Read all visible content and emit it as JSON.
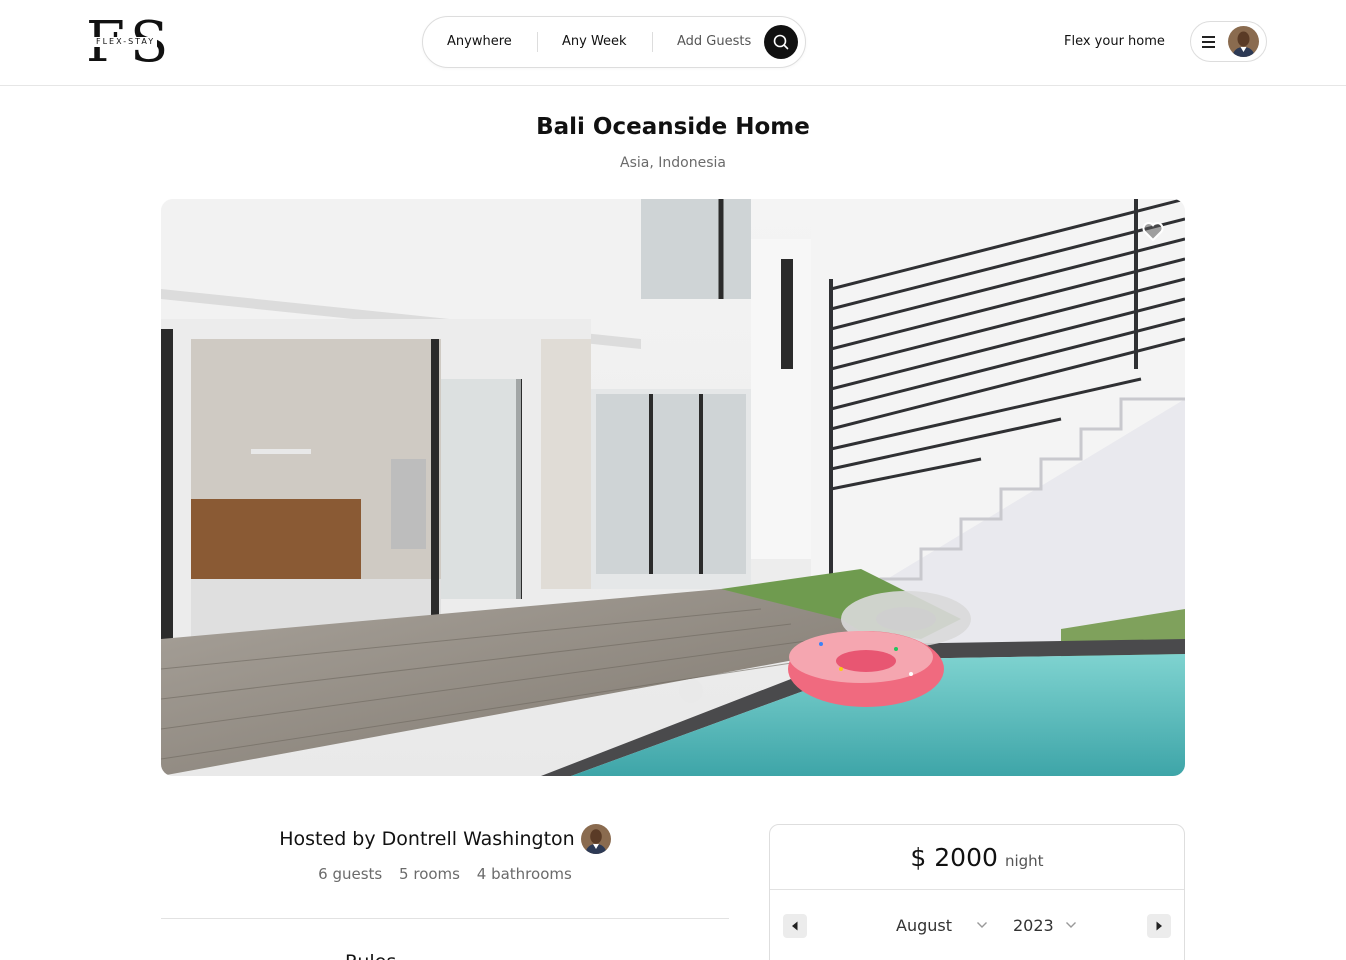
{
  "brand": {
    "monogram_left": "F",
    "monogram_right": "S",
    "wordmark": "FLEX-STAY"
  },
  "search": {
    "anywhere": "Anywhere",
    "any_week": "Any Week",
    "add_guests": "Add Guests",
    "button_icon": "search-icon"
  },
  "header": {
    "flex_your_home": "Flex your home",
    "menu_icon": "hamburger-icon"
  },
  "listing": {
    "title": "Bali Oceanside Home",
    "location": "Asia, Indonesia",
    "favorite_icon": "heart-icon"
  },
  "host": {
    "hosted_by": "Hosted by Dontrell Washington",
    "guests": "6 guests",
    "rooms": "5 rooms",
    "bathrooms": "4 bathrooms",
    "next_heading_partial": "Rules"
  },
  "booking": {
    "price": "$ 2000",
    "unit": "night",
    "month": "August",
    "year": "2023"
  },
  "colors": {
    "accent": "#111111",
    "muted_text": "#6b6b6b",
    "border": "#dddddd"
  }
}
